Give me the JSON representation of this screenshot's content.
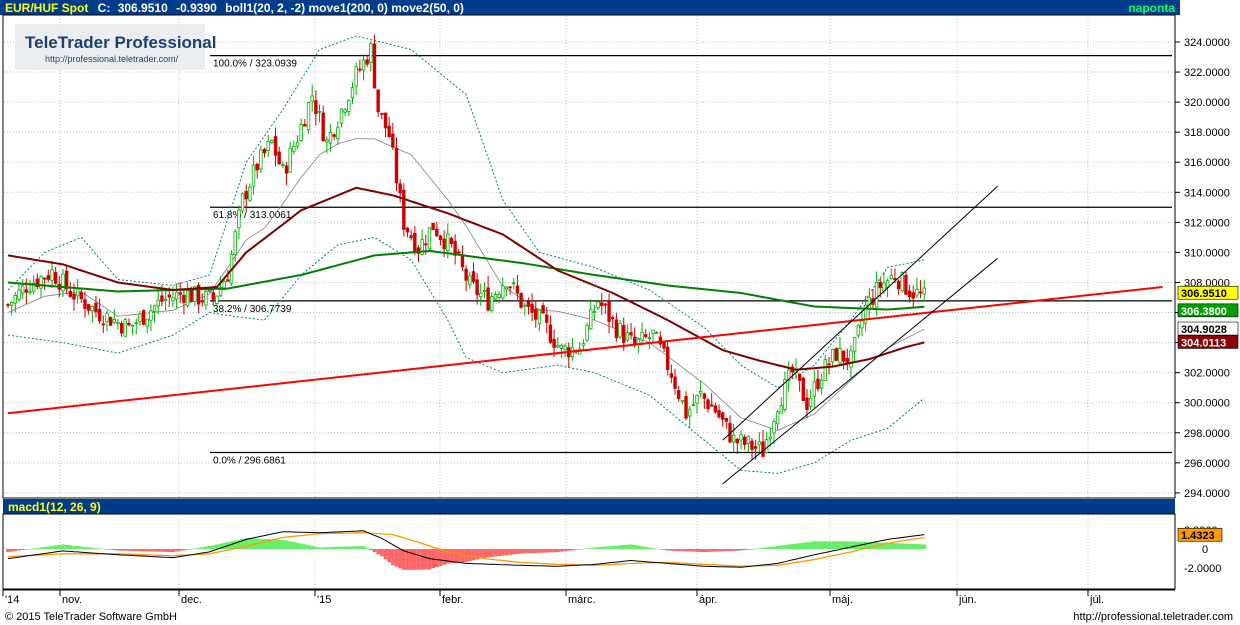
{
  "header": {
    "instrument": "EUR/HUF Spot",
    "close_label": "C:",
    "close_value": "306.9510",
    "change": "-0.9390",
    "studies": "boll1(20, 2, -2) move1(200, 0) move2(50, 0)",
    "period": "naponta"
  },
  "watermark": {
    "brand": "TeleTrader Professional",
    "url": "http://professional.teletrader.com/"
  },
  "price_axis": {
    "ticks": [
      "294.0000",
      "296.0000",
      "298.0000",
      "300.0000",
      "302.0000",
      "304.0000",
      "306.0000",
      "308.0000",
      "310.0000",
      "312.0000",
      "314.0000",
      "316.0000",
      "318.0000",
      "320.0000",
      "322.0000",
      "324.0000"
    ]
  },
  "price_badges": [
    {
      "text": "306.9510",
      "value": 306.951,
      "bg": "#ffff00",
      "fg": "#000000"
    },
    {
      "text": "306.3800",
      "value": 306.38,
      "bg": "#00a000",
      "fg": "#ffffff"
    },
    {
      "text": "304.9028",
      "value": 304.9028,
      "bg": "#ffffff",
      "fg": "#000000"
    },
    {
      "text": "304.0113",
      "value": 304.0113,
      "bg": "#8b0000",
      "fg": "#ffffff"
    }
  ],
  "fib_levels": [
    {
      "label": "100.0% / 323.0939",
      "value": 323.0939
    },
    {
      "label": "61.8% / 313.0061",
      "value": 313.0061
    },
    {
      "label": "38.2% / 306.7739",
      "value": 306.7739
    },
    {
      "label": "0.0% / 296.6861",
      "value": 296.6861
    }
  ],
  "macd": {
    "label": "macd1(12, 26, 9)",
    "ticks": [
      "2.0000",
      "0",
      "-2.0000"
    ],
    "badge": "1.4323"
  },
  "x_axis": {
    "labels": [
      "'14",
      "nov.",
      "dec.",
      "'15",
      "febr.",
      "márc.",
      "ápr.",
      "máj.",
      "jún.",
      "júl."
    ]
  },
  "footer": {
    "copyright": "© 2015 TeleTrader Software GmbH",
    "url": "http://professional.teletrader.com"
  },
  "colors": {
    "background": "#ffffff",
    "header_bg": "#003c8c",
    "grid": "#c0c0c0",
    "up_candle": "#00b000",
    "down_candle": "#d00000",
    "ma200": "#008000",
    "ma50": "#800000",
    "trendline": "#ff0000",
    "bollinger": "#008080",
    "macd_line": "#000000",
    "signal_line": "#ff9900",
    "hist_pos": "#66ee66",
    "hist_neg": "#ff6666"
  },
  "chart_data": {
    "type": "candlestick",
    "title": "EUR/HUF Spot",
    "period": "daily",
    "ylim": [
      294,
      325
    ],
    "last_close": 306.951,
    "change": -0.939,
    "series": [
      {
        "name": "EUR/HUF Spot",
        "anchor_closes": [
          [
            0,
            306.5
          ],
          [
            5,
            307.8
          ],
          [
            12,
            308.7
          ],
          [
            17,
            307.4
          ],
          [
            24,
            306.1
          ],
          [
            33,
            305.0
          ],
          [
            42,
            306.8
          ],
          [
            48,
            307.3
          ],
          [
            52,
            307.0
          ],
          [
            56,
            306.9
          ],
          [
            60,
            308.6
          ],
          [
            64,
            313.5
          ],
          [
            68,
            315.8
          ],
          [
            72,
            317.3
          ],
          [
            75,
            315.3
          ],
          [
            79,
            317.7
          ],
          [
            83,
            320.5
          ],
          [
            87,
            317.3
          ],
          [
            91,
            319.5
          ],
          [
            95,
            321.8
          ],
          [
            99,
            323.5
          ],
          [
            101,
            319.5
          ],
          [
            104,
            317.8
          ],
          [
            108,
            312.0
          ],
          [
            112,
            310.3
          ],
          [
            116,
            311.8
          ],
          [
            121,
            310.3
          ],
          [
            126,
            307.8
          ],
          [
            131,
            306.8
          ],
          [
            136,
            308.3
          ],
          [
            141,
            306.3
          ],
          [
            146,
            305.3
          ],
          [
            151,
            303.5
          ],
          [
            156,
            303.7
          ],
          [
            161,
            306.8
          ],
          [
            166,
            305.0
          ],
          [
            171,
            303.8
          ],
          [
            176,
            304.5
          ],
          [
            181,
            302.0
          ],
          [
            185,
            299.3
          ],
          [
            189,
            300.5
          ],
          [
            193,
            299.5
          ],
          [
            198,
            297.5
          ],
          [
            202,
            297.2
          ],
          [
            206,
            296.8
          ],
          [
            210,
            300.0
          ],
          [
            214,
            302.0
          ],
          [
            218,
            300.0
          ],
          [
            222,
            302.0
          ],
          [
            226,
            303.3
          ],
          [
            230,
            302.8
          ],
          [
            234,
            306.3
          ],
          [
            238,
            307.8
          ],
          [
            242,
            308.5
          ],
          [
            246,
            307.5
          ],
          [
            250,
            307.0
          ]
        ]
      },
      {
        "name": "move1(200, 0)",
        "anchor_values": [
          [
            0,
            308.0
          ],
          [
            30,
            307.4
          ],
          [
            60,
            307.6
          ],
          [
            80,
            308.5
          ],
          [
            100,
            309.8
          ],
          [
            115,
            310.1
          ],
          [
            140,
            309.3
          ],
          [
            160,
            308.5
          ],
          [
            180,
            307.8
          ],
          [
            200,
            307.3
          ],
          [
            220,
            306.4
          ],
          [
            240,
            306.2
          ],
          [
            250,
            306.38
          ]
        ]
      },
      {
        "name": "move2(50, 0)",
        "anchor_values": [
          [
            0,
            309.8
          ],
          [
            15,
            309.2
          ],
          [
            30,
            308.0
          ],
          [
            45,
            307.5
          ],
          [
            57,
            307.7
          ],
          [
            65,
            310.0
          ],
          [
            80,
            312.8
          ],
          [
            95,
            314.3
          ],
          [
            105,
            313.8
          ],
          [
            120,
            312.6
          ],
          [
            135,
            311.2
          ],
          [
            150,
            308.8
          ],
          [
            165,
            307.3
          ],
          [
            180,
            305.5
          ],
          [
            195,
            303.5
          ],
          [
            205,
            302.8
          ],
          [
            215,
            302.2
          ],
          [
            225,
            302.4
          ],
          [
            235,
            302.9
          ],
          [
            245,
            303.7
          ],
          [
            250,
            304.01
          ]
        ]
      },
      {
        "name": "boll1(20, 2, -2)",
        "upper": [
          [
            0,
            307.5
          ],
          [
            10,
            310.0
          ],
          [
            20,
            311.0
          ],
          [
            30,
            308.2
          ],
          [
            45,
            307.8
          ],
          [
            55,
            308.5
          ],
          [
            65,
            316.0
          ],
          [
            75,
            319.5
          ],
          [
            85,
            323.5
          ],
          [
            95,
            324.4
          ],
          [
            110,
            323.5
          ],
          [
            125,
            320.5
          ],
          [
            135,
            313.5
          ],
          [
            145,
            310.0
          ],
          [
            160,
            309.0
          ],
          [
            175,
            307.5
          ],
          [
            190,
            305.0
          ],
          [
            200,
            302.5
          ],
          [
            210,
            301.0
          ],
          [
            220,
            302.5
          ],
          [
            230,
            305.5
          ],
          [
            240,
            309.0
          ],
          [
            250,
            309.5
          ]
        ],
        "lower": [
          [
            0,
            304.5
          ],
          [
            15,
            304.0
          ],
          [
            30,
            303.3
          ],
          [
            45,
            304.5
          ],
          [
            55,
            306.0
          ],
          [
            60,
            305.8
          ],
          [
            70,
            305.5
          ],
          [
            80,
            308.5
          ],
          [
            90,
            310.5
          ],
          [
            100,
            311.0
          ],
          [
            110,
            309.5
          ],
          [
            120,
            305.5
          ],
          [
            125,
            303.0
          ],
          [
            135,
            302.0
          ],
          [
            150,
            302.5
          ],
          [
            160,
            302.0
          ],
          [
            175,
            300.5
          ],
          [
            190,
            297.5
          ],
          [
            200,
            295.5
          ],
          [
            210,
            295.3
          ],
          [
            220,
            296.0
          ],
          [
            230,
            297.5
          ],
          [
            240,
            298.3
          ],
          [
            250,
            300.3
          ]
        ]
      }
    ],
    "lines": [
      {
        "name": "trendline",
        "from": [
          0,
          299.3
        ],
        "to": [
          315,
          307.7
        ]
      }
    ],
    "fibonacci": [
      {
        "level": "100.0%",
        "value": 323.0939
      },
      {
        "level": "61.8%",
        "value": 313.0061
      },
      {
        "level": "38.2%",
        "value": 306.7739
      },
      {
        "level": "0.0%",
        "value": 296.6861
      }
    ],
    "macd": {
      "name": "macd1(12, 26, 9)",
      "ylim": [
        -3,
        3
      ],
      "last": 1.4323,
      "macd_anchors": [
        [
          0,
          -1.0
        ],
        [
          15,
          -0.2
        ],
        [
          30,
          -0.6
        ],
        [
          45,
          -0.9
        ],
        [
          55,
          -0.3
        ],
        [
          65,
          1.0
        ],
        [
          75,
          1.8
        ],
        [
          85,
          1.7
        ],
        [
          97,
          1.9
        ],
        [
          102,
          1.1
        ],
        [
          108,
          -0.2
        ],
        [
          115,
          -1.0
        ],
        [
          125,
          -1.5
        ],
        [
          140,
          -1.7
        ],
        [
          150,
          -1.8
        ],
        [
          160,
          -1.6
        ],
        [
          170,
          -1.2
        ],
        [
          180,
          -1.5
        ],
        [
          190,
          -1.8
        ],
        [
          200,
          -1.9
        ],
        [
          210,
          -1.5
        ],
        [
          220,
          -0.6
        ],
        [
          230,
          0.2
        ],
        [
          240,
          1.0
        ],
        [
          250,
          1.5
        ]
      ],
      "signal_anchors": [
        [
          0,
          -0.8
        ],
        [
          15,
          -0.5
        ],
        [
          30,
          -0.5
        ],
        [
          45,
          -0.7
        ],
        [
          55,
          -0.5
        ],
        [
          65,
          0.3
        ],
        [
          75,
          1.2
        ],
        [
          85,
          1.6
        ],
        [
          97,
          1.7
        ],
        [
          105,
          1.5
        ],
        [
          112,
          0.7
        ],
        [
          120,
          -0.3
        ],
        [
          130,
          -1.0
        ],
        [
          140,
          -1.4
        ],
        [
          150,
          -1.6
        ],
        [
          160,
          -1.7
        ],
        [
          170,
          -1.5
        ],
        [
          180,
          -1.4
        ],
        [
          190,
          -1.6
        ],
        [
          200,
          -1.8
        ],
        [
          210,
          -1.7
        ],
        [
          220,
          -1.1
        ],
        [
          230,
          -0.3
        ],
        [
          240,
          0.6
        ],
        [
          250,
          1.2
        ]
      ]
    },
    "xlabel": "",
    "ylabel": "",
    "x_ticks": [
      "'14",
      "nov.",
      "dec.",
      "'15",
      "febr.",
      "márc.",
      "ápr.",
      "máj.",
      "jún.",
      "júl."
    ],
    "grid": true
  }
}
